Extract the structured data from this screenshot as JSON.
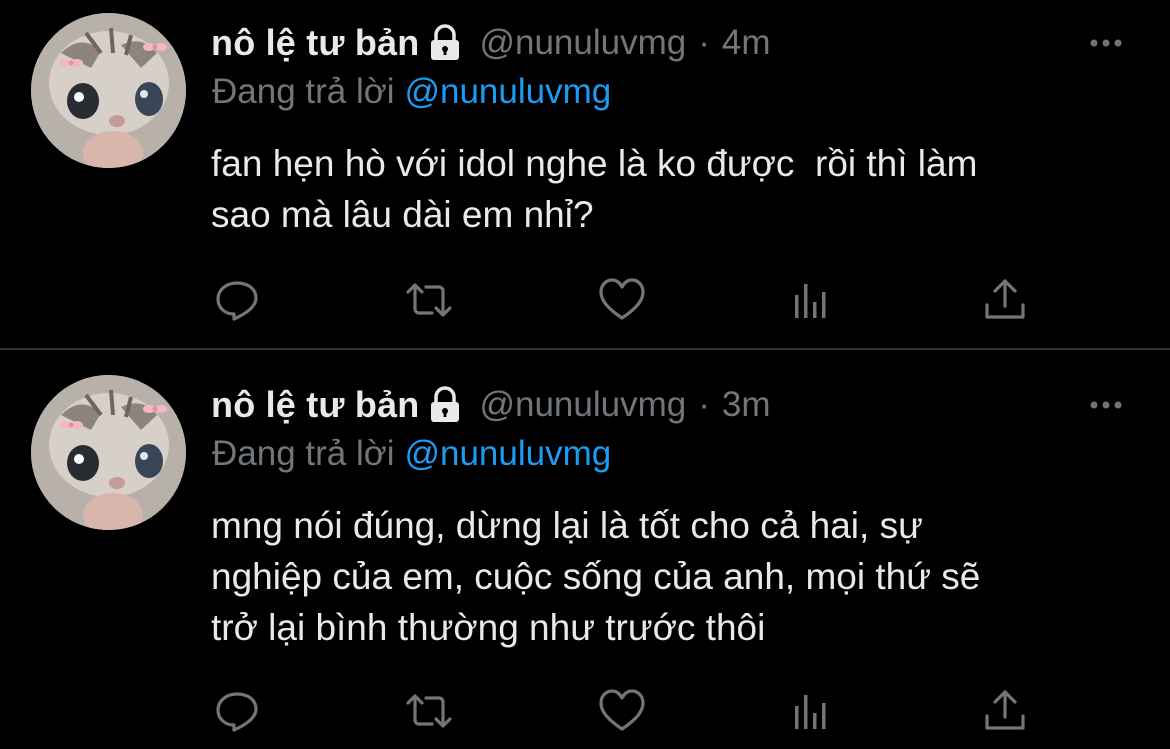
{
  "tweets": [
    {
      "author": {
        "name": "nô lệ tư bản",
        "handle": "@nunuluvmg"
      },
      "separator": "·",
      "time": "4m",
      "reply_prefix": "Đang trả lời",
      "reply_to": "@nunuluvmg",
      "text_lines": [
        "fan hẹn hò với idol nghe là ko được  rồi thì làm",
        "sao mà lâu dài em nhỉ?"
      ]
    },
    {
      "author": {
        "name": "nô lệ tư bản",
        "handle": "@nunuluvmg"
      },
      "separator": "·",
      "time": "3m",
      "reply_prefix": "Đang trả lời",
      "reply_to": "@nunuluvmg",
      "text_lines": [
        "mng nói đúng, dừng lại là tốt cho cả hai, sự",
        "nghiệp của em, cuộc sống của anh, mọi thứ sẽ",
        "trở lại bình thường như trước thôi"
      ]
    }
  ],
  "icons": {
    "lock": "lock-icon",
    "more": "more-dots-icon",
    "actions": [
      "reply-icon",
      "retweet-icon",
      "like-icon",
      "analytics-icon",
      "share-icon"
    ]
  },
  "colors": {
    "background": "#000000",
    "text": "#e7e9ea",
    "muted": "#71767b",
    "link": "#1d9bf0",
    "divider": "#2f3336"
  }
}
